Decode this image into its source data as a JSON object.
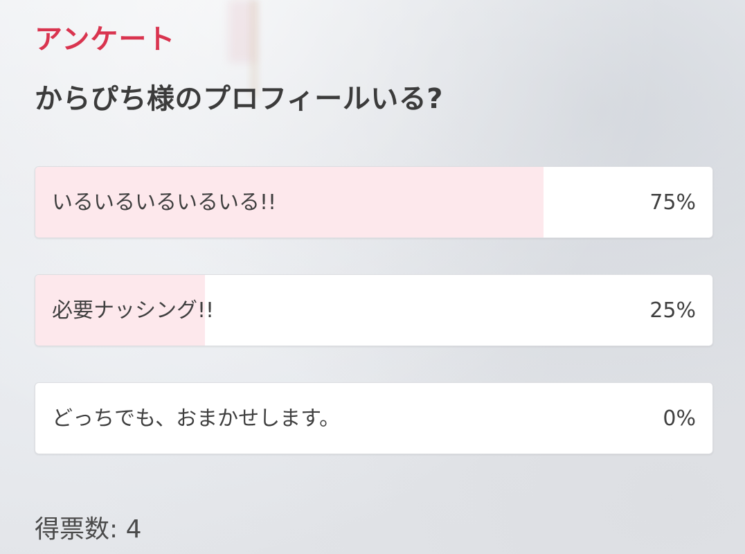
{
  "survey": {
    "label": "アンケート",
    "question": "からぴち様のプロフィールいる?",
    "accent_color": "#d9344f",
    "fill_color": "#fde8ec",
    "options": [
      {
        "text": "いるいるいるいるいる!!",
        "percent_label": "75%",
        "percent": 75
      },
      {
        "text": "必要ナッシング!!",
        "percent_label": "25%",
        "percent": 25
      },
      {
        "text": "どっちでも、おまかせします。",
        "percent_label": "0%",
        "percent": 0
      }
    ],
    "votes_label": "得票数: 4"
  }
}
